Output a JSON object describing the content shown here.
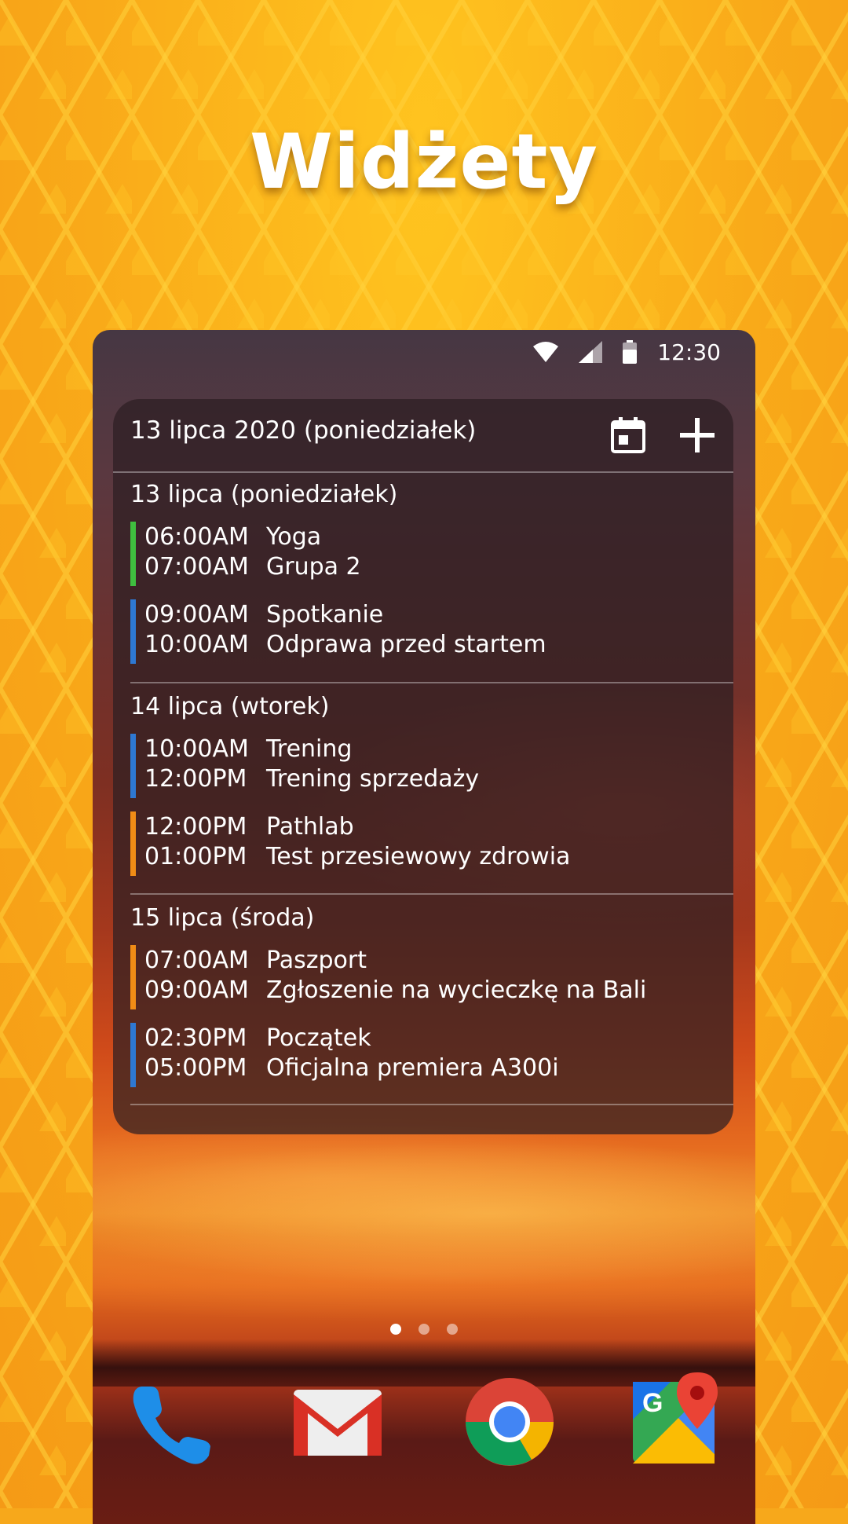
{
  "promo": {
    "title": "Widżety"
  },
  "statusbar": {
    "time": "12:30"
  },
  "widget": {
    "header_title": "13 lipca 2020 (poniedziałek)",
    "calendar_button": "calendar-icon",
    "add_button": "plus-icon",
    "days": [
      {
        "title": "13 lipca (poniedziałek)",
        "events": [
          {
            "start": "06:00AM",
            "title": "Yoga",
            "end": "07:00AM",
            "subtitle": "Grupa 2",
            "color": "#3fbf3f"
          },
          {
            "start": "09:00AM",
            "title": "Spotkanie",
            "end": "10:00AM",
            "subtitle": "Odprawa przed startem",
            "color": "#2e78d2"
          }
        ]
      },
      {
        "title": "14 lipca (wtorek)",
        "events": [
          {
            "start": "10:00AM",
            "title": "Trening",
            "end": "12:00PM",
            "subtitle": "Trening sprzedaży",
            "color": "#2e78d2"
          },
          {
            "start": "12:00PM",
            "title": "Pathlab",
            "end": "01:00PM",
            "subtitle": "Test przesiewowy zdrowia",
            "color": "#f08c16"
          }
        ]
      },
      {
        "title": "15 lipca (środa)",
        "events": [
          {
            "start": "07:00AM",
            "title": "Paszport",
            "end": "09:00AM",
            "subtitle": "Zgłoszenie na wycieczkę na Bali",
            "color": "#f08c16"
          },
          {
            "start": "02:30PM",
            "title": "Początek",
            "end": "05:00PM",
            "subtitle": "Oficjalna premiera A300i",
            "color": "#2e78d2"
          }
        ]
      }
    ]
  },
  "pager": {
    "pages": 3,
    "active": 0
  },
  "dock": [
    "phone-icon",
    "gmail-icon",
    "chrome-icon",
    "maps-icon"
  ]
}
